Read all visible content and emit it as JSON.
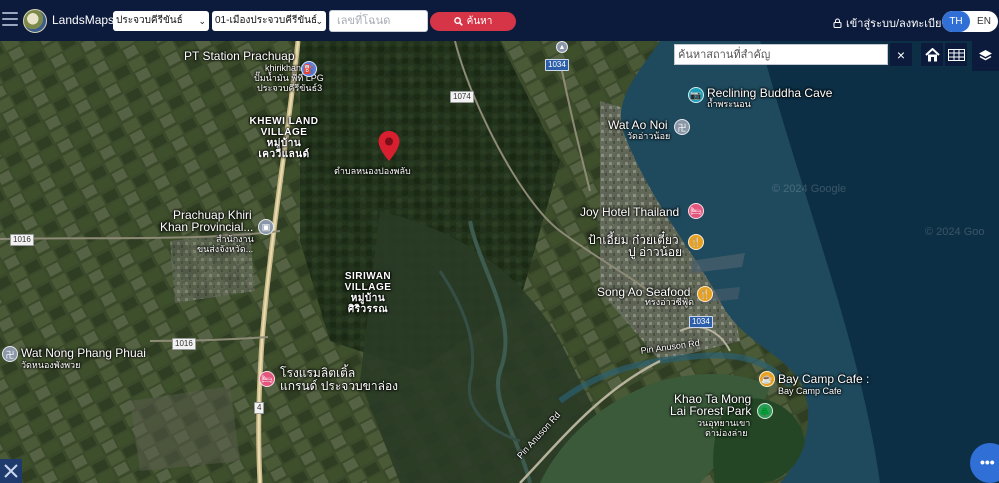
{
  "header": {
    "brand": "LandsMaps",
    "province_select": "ประจวบคีรีขันธ์",
    "district_select": "01-เมืองประจวบคีรีขันธ์",
    "deed_placeholder": "เลขที่โฉนด",
    "search_label": "ค้นหา",
    "login_label": "เข้าสู่ระบบ/ลงทะเบียน",
    "lang_th": "TH",
    "lang_en": "EN"
  },
  "map_controls": {
    "search_placeholder": "ค้นหาสถานที่สำคัญ",
    "clear": "×"
  },
  "map": {
    "pin_label": "ตำบลหนองปองพลับ",
    "labels": {
      "pt_station": "PT Station Prachuap",
      "pt_station_th1": "khirikhan3",
      "pt_station_th2": "ปั๊มน้ำมัน พีที LPG",
      "pt_station_th3": "ประจวบคีรีขันธ์3",
      "khewi_1": "KHEWI LAND",
      "khewi_2": "VILLAGE",
      "khewi_3": "หมู่บ้าน",
      "khewi_4": "เคววีแลนด์",
      "reclining": "Reclining Buddha Cave",
      "reclining_th": "ถ้ำพระนอน",
      "wat_ao_noi": "Wat Ao Noi",
      "wat_ao_noi_th": "วัดอ่าวน้อย",
      "prachuap_1": "Prachuap Khiri",
      "prachuap_2": "Khan Provincial...",
      "prachuap_th1": "สำนักงาน",
      "prachuap_th2": "ขนส่งจังหวัด...",
      "joy_hotel": "Joy Hotel Thailand",
      "pa_eam_1": "ป้าเอี้ยม ก๋วยเตี๋ยว",
      "pa_eam_2": "ปู อ่าวน้อย",
      "siriwan_1": "SIRIWAN",
      "siriwan_2": "VILLAGE",
      "siriwan_3": "หมู่บ้าน",
      "siriwan_4": "ศิริวรรณ",
      "song_ao": "Song Ao Seafood",
      "song_ao_th": "ทรงอ่าวซีฟู้ด",
      "wat_nong_1": "Wat Nong Phang Phuai",
      "wat_nong_2": "วัดหนองพังพวย",
      "hotel_1": "โรงแรมลิตเติ้ล",
      "hotel_2": "แกรนด์ ประจวบขาล่อง",
      "pin_anuson": "Pin Anuson Rd",
      "pin_anuson_2": "Pin Anuson Rd",
      "bay_camp_1": "Bay Camp Cafe :",
      "bay_camp_2": "Bay Camp Cafe",
      "khao_ta_1": "Khao Ta Mong",
      "khao_ta_2": "Lai Forest Park",
      "khao_ta_3": "วนอุทยานเขา",
      "khao_ta_4": "ตาม่องล่าย",
      "watermark_1": "© 2024 Google",
      "watermark_2": "© 2024 Goo"
    },
    "road_badges": {
      "r1034a": "1034",
      "r1074": "1074",
      "r1016a": "1016",
      "r1016b": "1016",
      "r1034b": "1034",
      "r4": "4"
    }
  },
  "colors": {
    "header_bg": "#0c1b3c",
    "search_btn": "#d63547",
    "accent_blue": "#2f6fd6",
    "pin_red": "#d81f30"
  },
  "icons": [
    "hamburger-icon",
    "search-icon",
    "lock-icon",
    "home-icon",
    "grid-icon",
    "layers-icon",
    "tools-icon",
    "more-icon",
    "map-pin-icon"
  ]
}
